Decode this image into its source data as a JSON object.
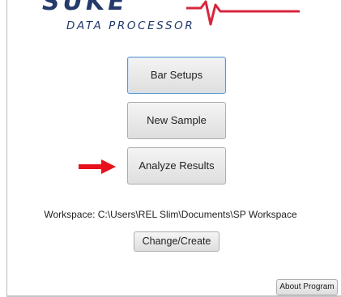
{
  "logo": {
    "top_text": "SUKE",
    "subtitle": "DATA PROCESSOR"
  },
  "buttons": {
    "bar_setups": "Bar Setups",
    "new_sample": "New Sample",
    "analyze_results": "Analyze Results",
    "change_create": "Change/Create",
    "about_program": "About Program"
  },
  "workspace": {
    "label": "Workspace: C:\\Users\\REL Slim\\Documents\\SP Workspace"
  },
  "colors": {
    "brand_navy": "#243a6b",
    "brand_red": "#d7263d",
    "focus_border": "#5f98cc",
    "arrow": "#e8111b"
  }
}
